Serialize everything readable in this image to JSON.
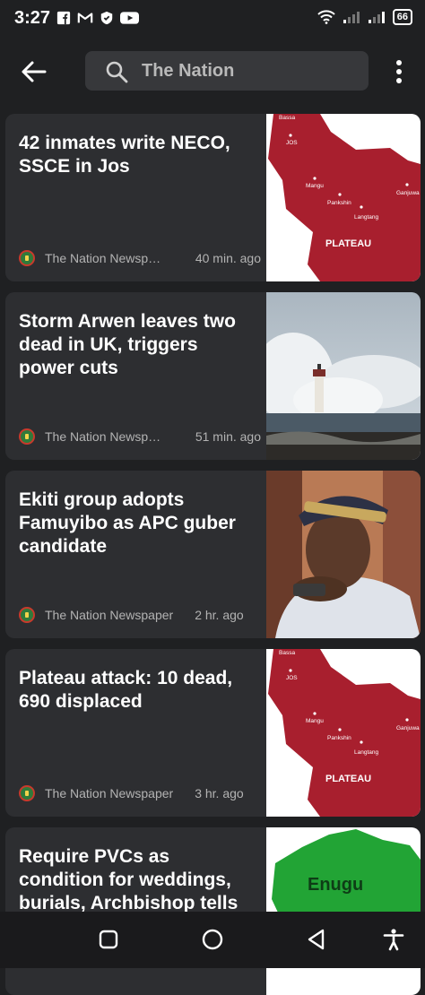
{
  "status_bar": {
    "time": "3:27",
    "battery": "66",
    "left_icons": [
      "facebook-icon",
      "gmail-icon",
      "shield-icon",
      "youtube-icon"
    ],
    "right_icons": [
      "wifi-icon",
      "signal-icon",
      "signal-icon",
      "battery-icon"
    ]
  },
  "app_bar": {
    "search_text": "The Nation"
  },
  "articles": [
    {
      "title": "42 inmates write NECO, SSCE in Jos",
      "source": "The Nation Newspaper",
      "time": "40 min. ago",
      "map_labels": [
        "Bassa",
        "JOS",
        "Mangu",
        "Pankshin",
        "Langtang",
        "Ganjuwa",
        "PLATEAU"
      ]
    },
    {
      "title": "Storm Arwen leaves two dead in UK, triggers power cuts",
      "source": "The Nation Newspaper",
      "time": "51 min. ago"
    },
    {
      "title": "Ekiti group adopts Famuyibo as APC guber candidate",
      "source": "The Nation Newspaper",
      "time": "2 hr. ago"
    },
    {
      "title": "Plateau attack: 10 dead, 690 displaced",
      "source": "The Nation Newspaper",
      "time": "3 hr. ago",
      "map_labels": [
        "Bassa",
        "JOS",
        "Mangu",
        "Pankshin",
        "Langtang",
        "Ganjuwa",
        "PLATEAU"
      ]
    },
    {
      "title": "Require PVCs as condition for weddings, burials, Archbishop tells",
      "map_labels": [
        "Enugu"
      ]
    }
  ],
  "nav_bar": {
    "buttons": [
      "recents-icon",
      "home-icon",
      "back-triangle-icon",
      "accessibility-icon"
    ]
  },
  "colors": {
    "background": "#1f2022",
    "card": "#2d2e31",
    "search_bg": "#37383b",
    "map_red": "#a81f2e",
    "map_green": "#22a435"
  }
}
